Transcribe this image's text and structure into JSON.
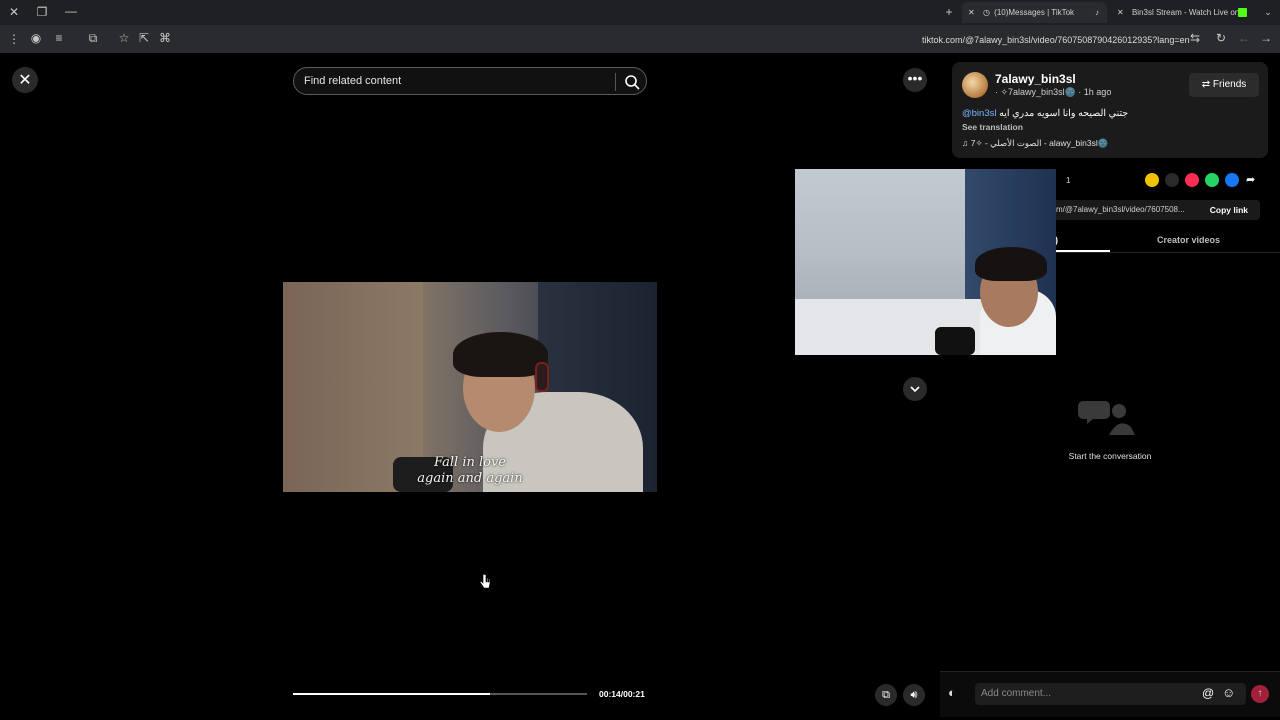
{
  "browser": {
    "tabs": [
      {
        "title": "(10)Messages | TikTok",
        "active": true
      },
      {
        "title": "Bin3sl Stream - Watch Live on K",
        "active": false
      }
    ],
    "url": "tiktok.com/@7alawy_bin3sl/video/7607508790426012935?lang=en"
  },
  "player": {
    "search_placeholder": "Find related content",
    "caption_line1": "Fall in love",
    "caption_line2": "again and again",
    "timecode": "00:14/00:21",
    "progress_fraction": 0.67
  },
  "info": {
    "username": "7alawy_bin3sl",
    "subline_handle": "· ✧7alawy_bin3sl🌚",
    "subline_time": "· 1h ago",
    "friends_label": "Friends",
    "description_mention": "@bin3sl",
    "description_text": "جتني الصيحه وانا اسويه مدري ايه",
    "see_translation": "See translation",
    "music": "♫  7✧ - الصوت الأصلي - alawy_bin3sl🌚",
    "like_count": "1",
    "link_text": "m/@7alawy_bin3sl/video/7607508...",
    "copy_link_label": "Copy link",
    "tab_comments_label": "0)",
    "tab_creator_label": "Creator videos",
    "empty_text": "Start the conversation",
    "comment_placeholder": "Add comment..."
  },
  "colors": {
    "share_emoji": "#f2c200",
    "share_embed": "#2a2a2a",
    "share_send": "#fe2c55",
    "share_whatsapp": "#25d366",
    "share_facebook": "#1877f2",
    "post_button": "#a1203a"
  }
}
